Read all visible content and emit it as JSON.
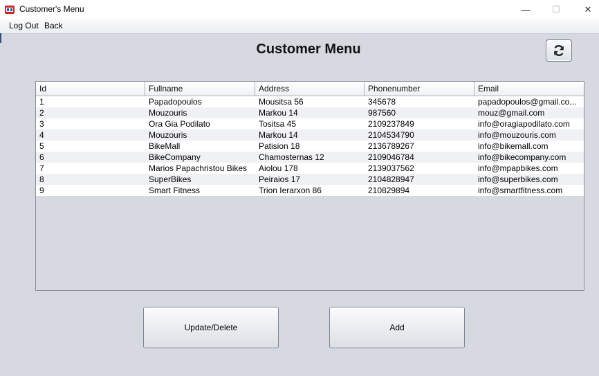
{
  "window": {
    "title": "Customer's Menu",
    "minimize_symbol": "—",
    "maximize_symbol": "☐",
    "close_symbol": "✕"
  },
  "menu": {
    "logout_label": "Log Out",
    "back_label": "Back"
  },
  "page": {
    "title": "Customer Menu"
  },
  "table": {
    "columns": [
      "Id",
      "Fullname",
      "Address",
      "Phonenumber",
      "Email"
    ],
    "rows": [
      [
        "1",
        "Papadopoulos",
        "Mousitsa 56",
        "345678",
        "papadopoulos@gmail.co..."
      ],
      [
        "2",
        "Mouzouris",
        "Markou 14",
        "987560",
        "mouz@gmail.com"
      ],
      [
        "3",
        "Ora Gia Podilato",
        "Tositsa 45",
        "2109237849",
        "info@oragiapodilato.com"
      ],
      [
        "4",
        "Mouzouris",
        "Markou 14",
        "2104534790",
        "info@mouzouris.com"
      ],
      [
        "5",
        "BikeMall",
        "Patision 18",
        "2136789267",
        "info@bikemall.com"
      ],
      [
        "6",
        "BikeCompany",
        "Chamosternas 12",
        "2109046784",
        "info@bikecompany.com"
      ],
      [
        "7",
        "Marios Papachristou Bikes",
        "Aiolou 178",
        "2139037562",
        "info@mpapbikes.com"
      ],
      [
        "8",
        "SuperBikes",
        "Peiraios 17",
        "2104828947",
        "info@superbikes.com"
      ],
      [
        "9",
        "Smart Fitness",
        "Trion Ierarxon 86",
        "210829894",
        "info@smartfitness.com"
      ]
    ]
  },
  "buttons": {
    "update_delete_label": "Update/Delete",
    "add_label": "Add",
    "refresh_icon": "refresh-icon"
  }
}
